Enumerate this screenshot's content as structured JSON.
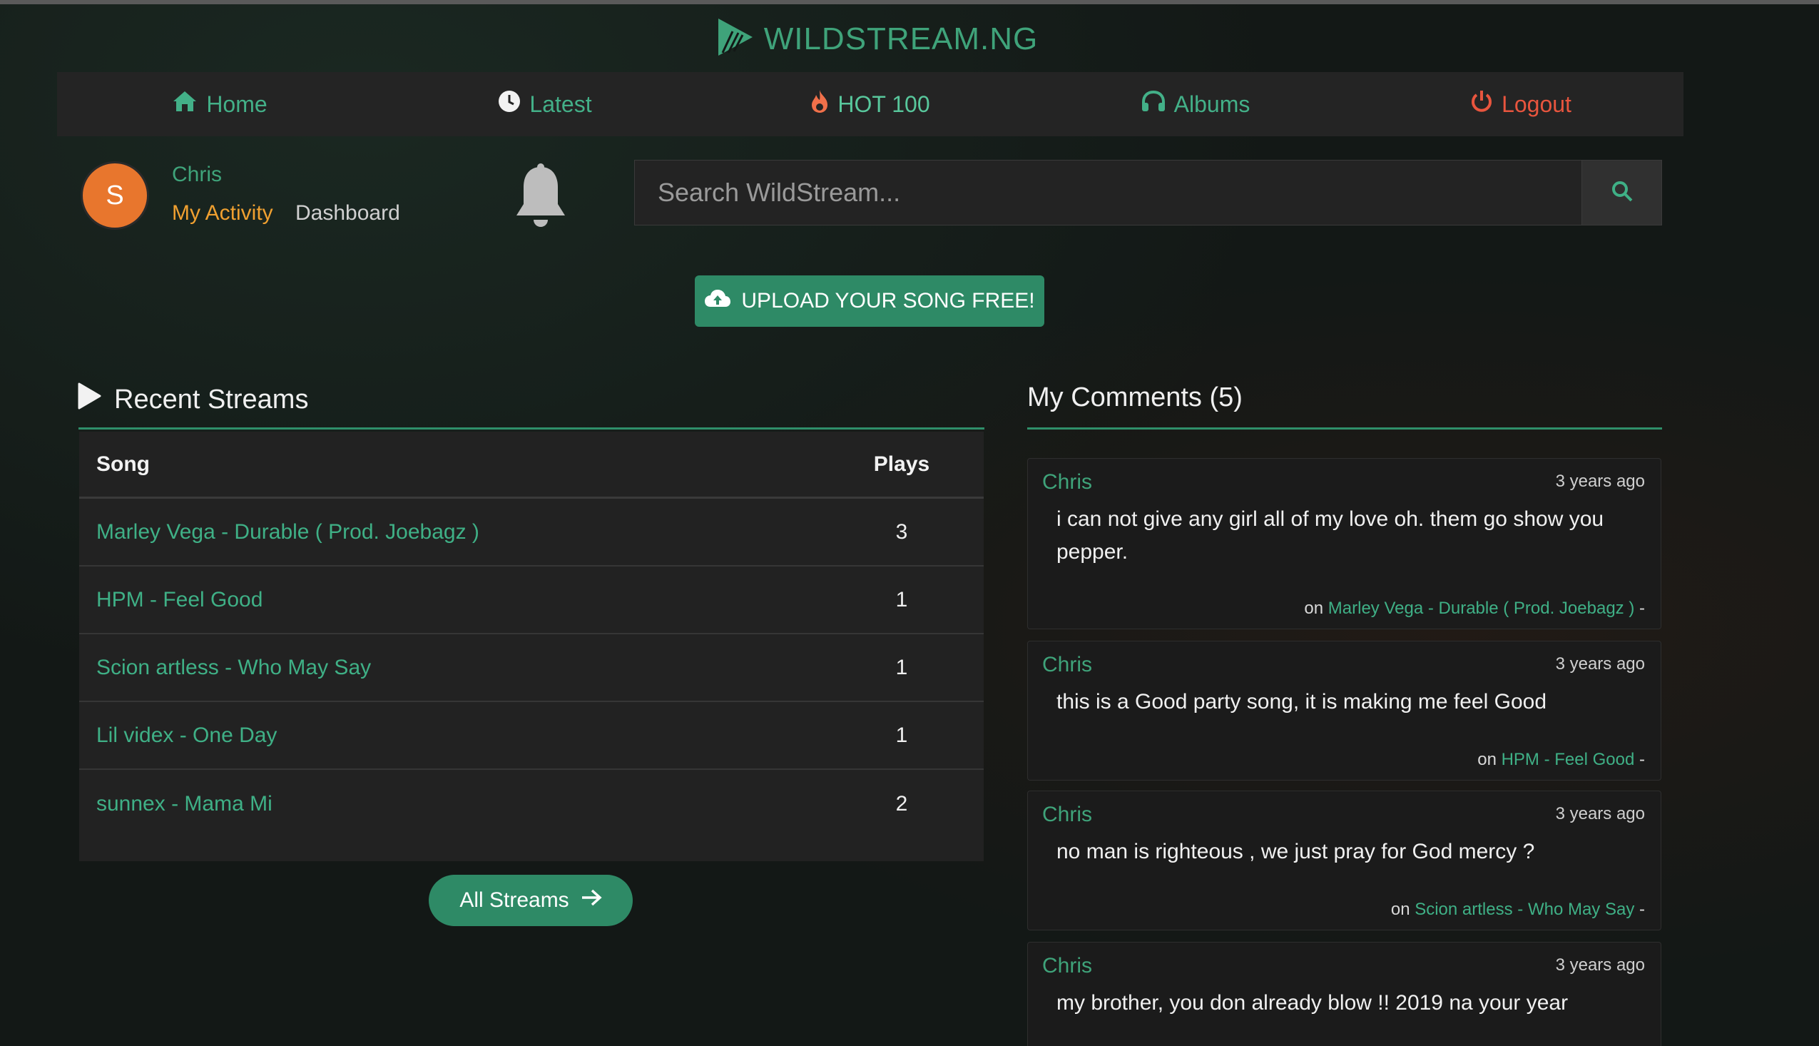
{
  "brand": {
    "name": "WILDSTREAM.NG"
  },
  "nav": {
    "home": "Home",
    "latest": "Latest",
    "hot": "HOT 100",
    "albums": "Albums",
    "logout": "Logout"
  },
  "user": {
    "initial": "S",
    "name": "Chris",
    "my_activity": "My Activity",
    "dashboard": "Dashboard"
  },
  "search": {
    "placeholder": "Search WildStream..."
  },
  "upload": {
    "label": "UPLOAD YOUR SONG FREE!"
  },
  "recent_streams": {
    "title": "Recent Streams",
    "col_song": "Song",
    "col_plays": "Plays",
    "rows": [
      {
        "song": "Marley Vega - Durable ( Prod. Joebagz )",
        "plays": "3"
      },
      {
        "song": "HPM - Feel Good",
        "plays": "1"
      },
      {
        "song": "Scion artless - Who May Say",
        "plays": "1"
      },
      {
        "song": "Lil videx - One Day",
        "plays": "1"
      },
      {
        "song": "sunnex - Mama Mi",
        "plays": "2"
      }
    ],
    "all_label": "All Streams"
  },
  "comments": {
    "title": "My Comments (5)",
    "items": [
      {
        "author": "Chris",
        "time": "3 years ago",
        "body": "i can not give any girl all of my love oh. them go show you pepper.",
        "on_prefix": "on",
        "song": "Marley Vega - Durable ( Prod. Joebagz )",
        "suffix": "-"
      },
      {
        "author": "Chris",
        "time": "3 years ago",
        "body": "this is a Good party song, it is making me feel Good",
        "on_prefix": "on",
        "song": "HPM - Feel Good",
        "suffix": "-"
      },
      {
        "author": "Chris",
        "time": "3 years ago",
        "body": "no man is righteous , we just pray for God mercy ?",
        "on_prefix": "on",
        "song": "Scion artless - Who May Say",
        "suffix": "-"
      },
      {
        "author": "Chris",
        "time": "3 years ago",
        "body": "my brother, you don already blow !! 2019 na your year"
      }
    ]
  },
  "colors": {
    "accent": "#3fa37a",
    "button": "#2e8a66",
    "hot": "#f0704a",
    "logout": "#e8553e",
    "activity": "#f0a030",
    "avatar": "#e8762d"
  },
  "icons": [
    "logo-icon",
    "home-icon",
    "clock-icon",
    "fire-icon",
    "headphones-icon",
    "power-icon",
    "bell-icon",
    "search-icon",
    "cloud-upload-icon",
    "play-icon",
    "arrow-right-icon"
  ]
}
